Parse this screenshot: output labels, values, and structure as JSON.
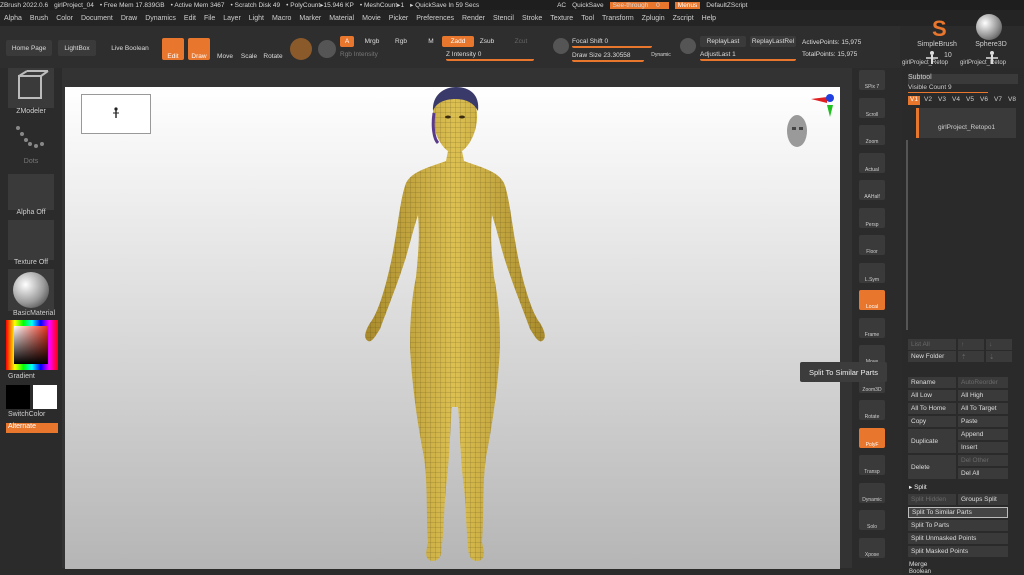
{
  "titlebar": {
    "app": "ZBrush 2022.0.6",
    "project": "girlProject_04",
    "free_mem": "• Free Mem 17.839GB",
    "active_mem": "• Active Mem 3467",
    "scratch": "• Scratch Disk 49",
    "poly": "• PolyCount▸15.946 KP",
    "mesh": "• MeshCount▸1",
    "quicksave_in": "▸ QuickSave In 59 Secs",
    "ac": "AC",
    "quicksave": "QuickSave",
    "see_through": "See-through",
    "see_through_val": "0",
    "menus": "Menus",
    "default_zscript": "DefaultZScript"
  },
  "menubar": [
    "Alpha",
    "Brush",
    "Color",
    "Document",
    "Draw",
    "Dynamics",
    "Edit",
    "File",
    "Layer",
    "Light",
    "Macro",
    "Marker",
    "Material",
    "Movie",
    "Picker",
    "Preferences",
    "Render",
    "Stencil",
    "Stroke",
    "Texture",
    "Tool",
    "Transform",
    "Zplugin",
    "Zscript",
    "Help"
  ],
  "toolbar": {
    "home": "Home Page",
    "lightbox": "LightBox",
    "live_boolean": "Live Boolean",
    "edit": "Edit",
    "draw": "Draw",
    "move": "Move",
    "scale": "Scale",
    "rotate": "Rotate",
    "a": "A",
    "mrgb": "Mrgb",
    "rgb": "Rgb",
    "m": "M",
    "zadd": "Zadd",
    "zsub": "Zsub",
    "zcut": "Zcut",
    "rgb_intensity": "Rgb Intensity",
    "z_intensity": "Z Intensity 0",
    "focal_shift": "Focal Shift 0",
    "draw_size": "Draw Size 23.30558",
    "dynamic": "Dynamic",
    "replay_last": "ReplayLast",
    "replay_last_rel": "ReplayLastRel",
    "adjust_last": "AdjustLast 1",
    "active_points": "ActivePoints: 15,975",
    "total_points": "TotalPoints: 15,975"
  },
  "leftpanel": {
    "zmodeler": "ZModeler",
    "dots": "Dots",
    "alpha_off": "Alpha Off",
    "texture_off": "Texture Off",
    "basic_material": "BasicMaterial",
    "gradient": "Gradient",
    "switch_color": "SwitchColor",
    "alternate": "Alternate"
  },
  "rightbar": [
    "SPix 7",
    "Scroll",
    "Zoom",
    "Actual",
    "AAHalf",
    "Persp",
    "Floor",
    "L.Sym",
    "Local",
    "Frame",
    "Move",
    "Zoom3D",
    "Rotate",
    "PolyF",
    "Transp",
    "Dynamic",
    "Solo",
    "Xpose"
  ],
  "tooltip": "Split To Similar Parts",
  "subpanel": {
    "simple_brush": "SimpleBrush",
    "sphere3d": "Sphere3D",
    "girl1": "girlProject_Retop",
    "num10": "10",
    "girl2": "girlProject_Retop",
    "subtool": "Subtool",
    "visible_count": "Visible Count 9",
    "versions": [
      "V1",
      "V2",
      "V3",
      "V4",
      "V5",
      "V6",
      "V7",
      "V8"
    ],
    "item_name": "girlProject_Retopo1",
    "list_all": "List All",
    "new_folder": "New Folder",
    "rename": "Rename",
    "autoreorder": "AutoReorder",
    "all_low": "All Low",
    "all_high": "All High",
    "all_to_home": "All To Home",
    "all_to_target": "All To Target",
    "copy": "Copy",
    "paste": "Paste",
    "duplicate": "Duplicate",
    "append": "Append",
    "insert": "Insert",
    "delete": "Delete",
    "del_other": "Del Other",
    "del_all": "Del All",
    "split": "▸ Split",
    "split_hidden": "Split Hidden",
    "groups_split": "Groups Split",
    "split_similar": "Split To Similar Parts",
    "split_parts": "Split To Parts",
    "split_unmasked": "Split Unmasked Points",
    "split_masked": "Split Masked Points",
    "merge": "Merge",
    "boolean": "Boolean"
  },
  "colors": {
    "accent": "#e8762d",
    "model": "#d7b84a",
    "bg": "#2b2b2b"
  }
}
